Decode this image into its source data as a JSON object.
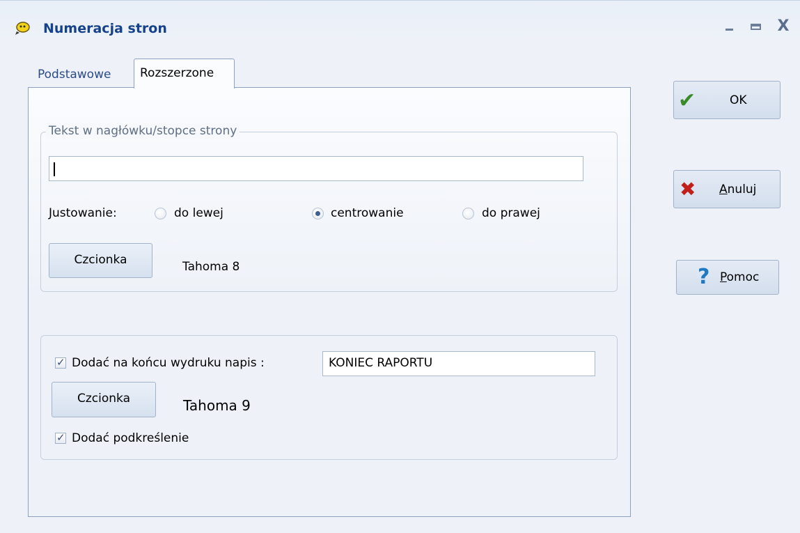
{
  "window": {
    "title": "Numeracja stron",
    "icon": "app-icon"
  },
  "tabs": [
    {
      "label": "Podstawowe",
      "active": false
    },
    {
      "label": "Rozszerzone",
      "active": true
    }
  ],
  "header_group": {
    "title": "Tekst w nagłówku/stopce strony",
    "text_value": "",
    "justification_label": "Justowanie:",
    "options": [
      {
        "label": "do lewej",
        "selected": false
      },
      {
        "label": "centrowanie",
        "selected": true
      },
      {
        "label": "do prawej",
        "selected": false
      }
    ],
    "font_button": "Czcionka",
    "font_value": "Tahoma 8"
  },
  "end_group": {
    "add_end_text_label": "Dodać na końcu wydruku napis :",
    "add_end_text_checked": true,
    "end_text_value": "KONIEC RAPORTU",
    "font_button": "Czcionka",
    "font_value": "Tahoma 9",
    "underline_label": "Dodać  podkreślenie",
    "underline_checked": true
  },
  "buttons": {
    "ok": {
      "label": "OK",
      "icon": "check-icon",
      "color": "#3a8a2a"
    },
    "cancel": {
      "label_hotkey": "A",
      "label_rest": "nuluj",
      "icon": "x-icon",
      "color": "#c0201a"
    },
    "help": {
      "label_hotkey": "P",
      "label_rest": "omoc",
      "icon": "question-icon",
      "color": "#1f79c2"
    }
  }
}
